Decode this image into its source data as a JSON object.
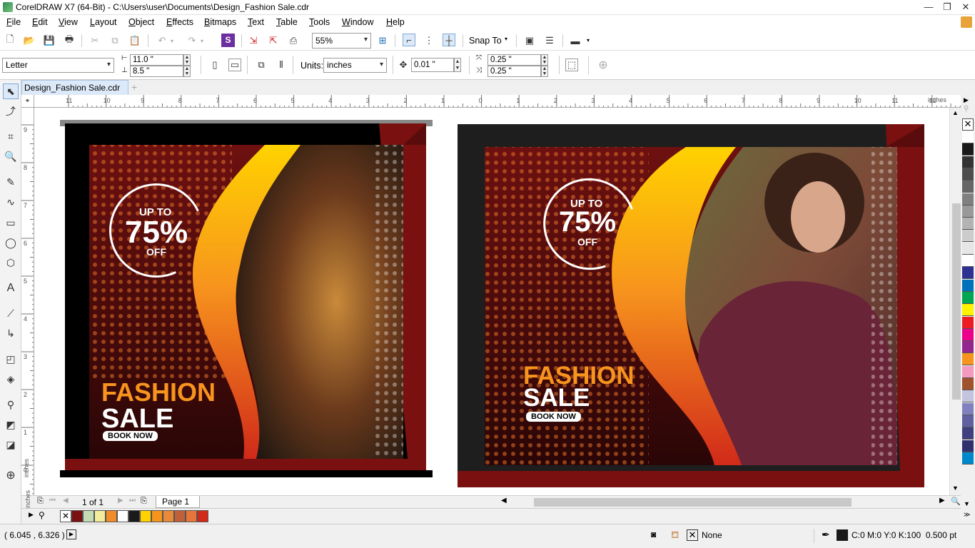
{
  "window": {
    "title": "CorelDRAW X7 (64-Bit) - C:\\Users\\user\\Documents\\Design_Fashion Sale.cdr",
    "minimize": "—",
    "restore": "❐",
    "close": "✕"
  },
  "menu": [
    {
      "label": "File"
    },
    {
      "label": "Edit"
    },
    {
      "label": "View"
    },
    {
      "label": "Layout"
    },
    {
      "label": "Object"
    },
    {
      "label": "Effects"
    },
    {
      "label": "Bitmaps"
    },
    {
      "label": "Text"
    },
    {
      "label": "Table"
    },
    {
      "label": "Tools"
    },
    {
      "label": "Window"
    },
    {
      "label": "Help"
    }
  ],
  "toolbar": {
    "zoom": "55%",
    "snap_to": "Snap To"
  },
  "property_bar": {
    "paper_size": "Letter",
    "width": "11.0 \"",
    "height": "8.5 \"",
    "units_label": "Units:",
    "units": "inches",
    "nudge": "0.01 \"",
    "dup_x": "0.25 \"",
    "dup_y": "0.25 \""
  },
  "document_tab": "Design_Fashion Sale.cdr",
  "ruler": {
    "h_ticks": [
      "11",
      "10",
      "9",
      "8",
      "7",
      "6",
      "5",
      "4",
      "3",
      "2",
      "1",
      "0",
      "1",
      "2",
      "3",
      "4",
      "5",
      "6",
      "7",
      "8",
      "9",
      "10",
      "11",
      "12"
    ],
    "h_unit": "inches",
    "v_ticks": [
      "9",
      "8",
      "7",
      "6",
      "5",
      "4",
      "3",
      "2",
      "1",
      "0"
    ],
    "v_unit": "inches"
  },
  "design_left": {
    "up_to": "UP TO",
    "discount": "75%",
    "off": "OFF",
    "headline": "FASHION",
    "subhead": "SALE",
    "cta": "BOOK NOW"
  },
  "design_right": {
    "up_to": "UP TO",
    "discount": "75%",
    "off": "OFF",
    "headline": "FASHION",
    "subhead": "SALE",
    "cta": "BOOK NOW"
  },
  "page_nav": {
    "count": "1 of 1",
    "page_tab": "Page 1"
  },
  "status": {
    "coords": "( 6.045 , 6.326 )",
    "fill_label": "None",
    "outline": "C:0 M:0 Y:0 K:100  0.500 pt"
  },
  "colors": {
    "accent_orange": "#f7941d",
    "maroon": "#7a1010",
    "yellow": "#ffd200",
    "red": "#d12a1a"
  },
  "palette_colors": [
    "#ffffff",
    "#1a1a1a",
    "#333333",
    "#4d4d4d",
    "#666666",
    "#808080",
    "#999999",
    "#b3b3b3",
    "#cccccc",
    "#e6e6e6",
    "#ffffff",
    "#2e3192",
    "#0072bc",
    "#00a651",
    "#fff200",
    "#ed1c24",
    "#ec008c",
    "#92278f",
    "#f7941d",
    "#f49ac1",
    "#a0522d",
    "#c4c4e0",
    "#8080c0",
    "#6060a0",
    "#404080",
    "#30306f",
    "#0088cc"
  ],
  "doc_palette_colors": [
    "#7a1010",
    "#c4dcb4",
    "#f2ec9c",
    "#f28c28",
    "#ffffff",
    "#1a1a1a",
    "#ffd200",
    "#f7941d",
    "#e9893a",
    "#c0603a",
    "#e8753c",
    "#d12a1a"
  ]
}
